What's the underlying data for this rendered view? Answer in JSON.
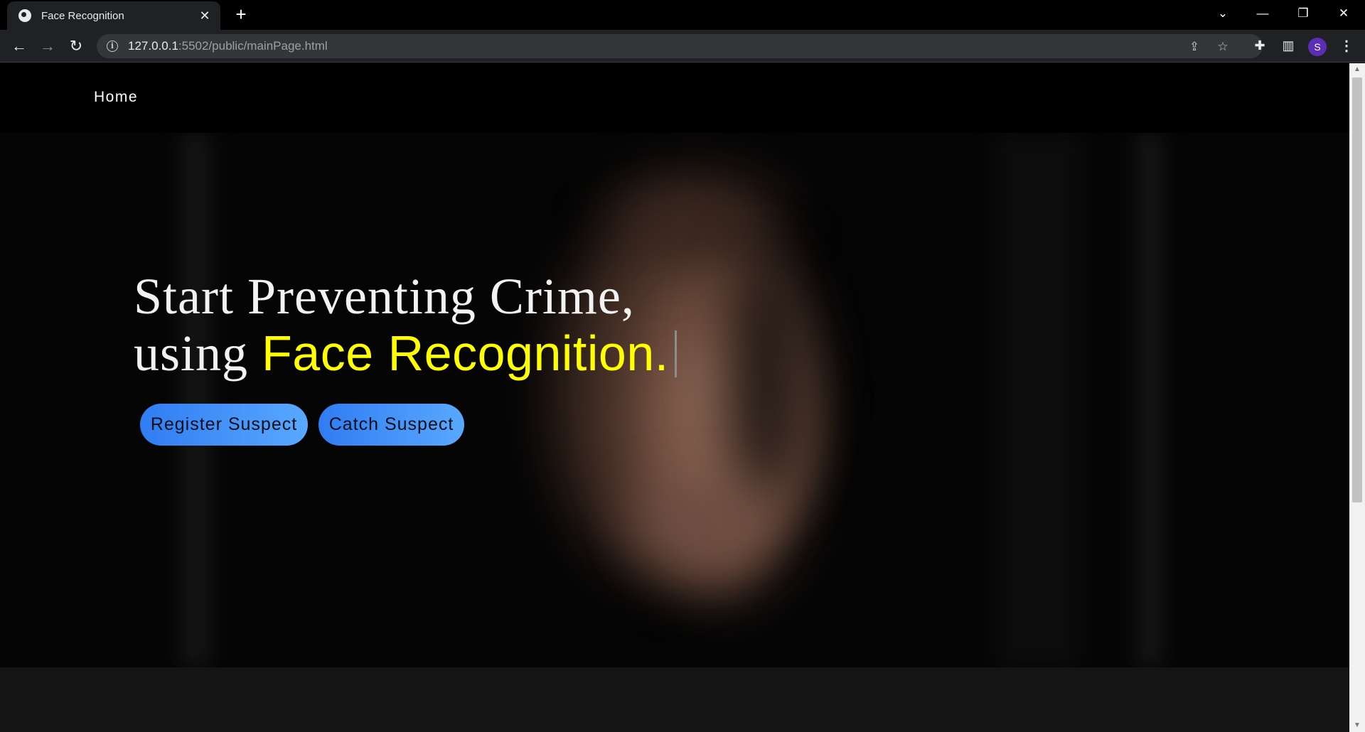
{
  "browser": {
    "tab_title": "Face Recognition",
    "tab_close": "✕",
    "new_tab": "+",
    "url_host": "127.0.0.1",
    "url_rest": ":5502/public/mainPage.html",
    "profile_initial": "S",
    "window_controls": {
      "dropdown": "⌄",
      "minimize": "—",
      "restore": "❐",
      "close": "✕"
    }
  },
  "page": {
    "nav": {
      "home": "Home"
    },
    "hero": {
      "line1": "Start Preventing Crime,",
      "line2_prefix": "using ",
      "line2_accent": "Face Recognition."
    },
    "buttons": {
      "register": "Register Suspect",
      "catch": "Catch Suspect"
    }
  },
  "colors": {
    "accent_yellow": "#ffff00",
    "button_gradient_start": "#2f7df2",
    "button_gradient_end": "#59a8ff",
    "background": "#000000"
  }
}
